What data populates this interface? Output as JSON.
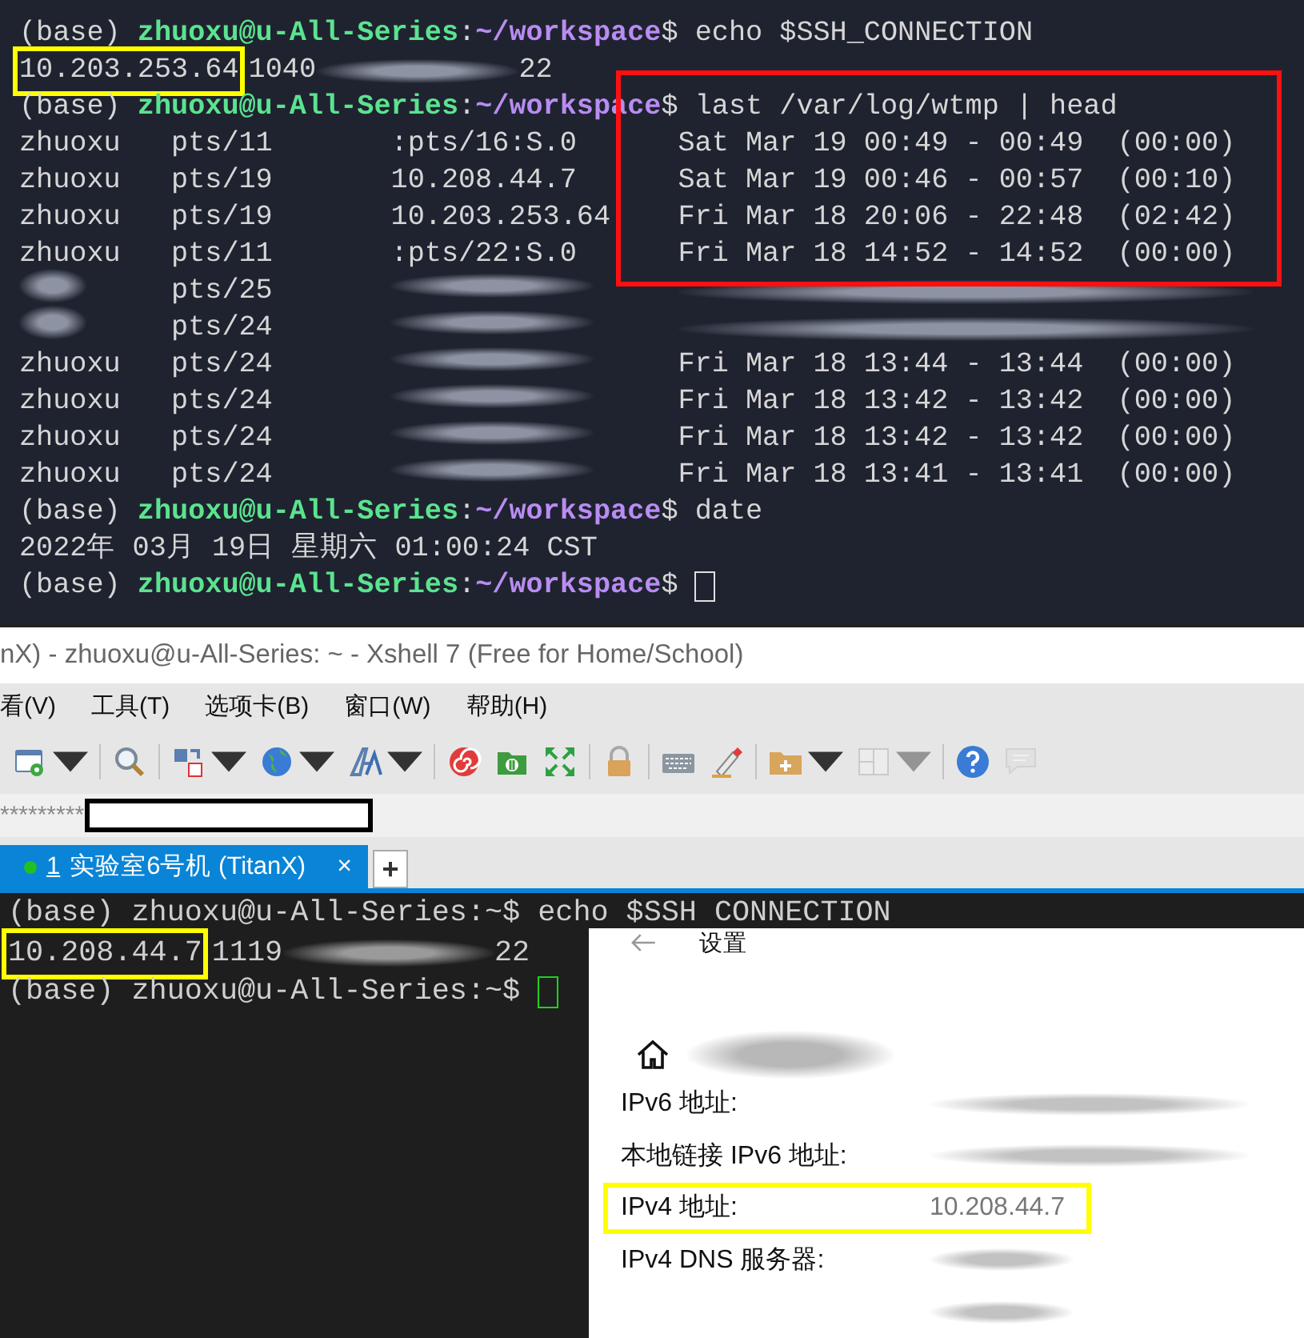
{
  "terminal_top": {
    "framed_region": true,
    "lines": [
      {
        "kind": "prompt",
        "env": "(base)",
        "user_host": "zhuoxu@u-All-Series",
        "separator": ":",
        "path": "~/workspace",
        "sigil": "$",
        "command": "echo $SSH_CONNECTION"
      },
      {
        "kind": "output",
        "segments": [
          {
            "kind": "text",
            "text": "10.203.253.64",
            "highlighted": true
          },
          {
            "kind": "text",
            "text": "1040"
          },
          {
            "kind": "blurred"
          },
          {
            "kind": "text",
            "text": "22"
          }
        ]
      },
      {
        "kind": "prompt",
        "env": "(base)",
        "user_host": "zhuoxu@u-All-Series",
        "separator": ":",
        "path": "~/workspace",
        "sigil": "$",
        "command": "last /var/log/wtmp | head"
      },
      {
        "kind": "login",
        "user": "zhuoxu",
        "tty": "pts/11",
        "from": ":pts/16:S.0",
        "time": "Sat Mar 19 00:49 - 00:49  (00:00)"
      },
      {
        "kind": "login",
        "user": "zhuoxu",
        "tty": "pts/19",
        "from": "10.208.44.7",
        "time": "Sat Mar 19 00:46 - 00:57  (00:10)"
      },
      {
        "kind": "login",
        "user": "zhuoxu",
        "tty": "pts/19",
        "from": "10.203.253.64",
        "time": "Fri Mar 18 20:06 - 22:48  (02:42)"
      },
      {
        "kind": "login",
        "user": "zhuoxu",
        "tty": "pts/11",
        "from": ":pts/22:S.0",
        "time": "Fri Mar 18 14:52 - 14:52  (00:00)"
      },
      {
        "kind": "login",
        "tty": "pts/25"
      },
      {
        "kind": "login",
        "tty": "pts/24"
      },
      {
        "kind": "login",
        "user": "zhuoxu",
        "tty": "pts/24",
        "time": "Fri Mar 18 13:44 - 13:44  (00:00)"
      },
      {
        "kind": "login",
        "user": "zhuoxu",
        "tty": "pts/24",
        "time": "Fri Mar 18 13:42 - 13:42  (00:00)"
      },
      {
        "kind": "login",
        "user": "zhuoxu",
        "tty": "pts/24",
        "time": "Fri Mar 18 13:42 - 13:42  (00:00)"
      },
      {
        "kind": "login",
        "user": "zhuoxu",
        "tty": "pts/24",
        "time": "Fri Mar 18 13:41 - 13:41  (00:00)"
      },
      {
        "kind": "prompt",
        "env": "(base)",
        "user_host": "zhuoxu@u-All-Series",
        "separator": ":",
        "path": "~/workspace",
        "sigil": "$",
        "command": "date"
      },
      {
        "kind": "output",
        "segments": [
          {
            "kind": "text",
            "text": "2022年 03月 19日 星期六 01:00:24 CST"
          }
        ]
      },
      {
        "kind": "prompt",
        "env": "(base)",
        "user_host": "zhuoxu@u-All-Series",
        "separator": ":",
        "path": "~/workspace",
        "sigil": "$",
        "cursor": true
      }
    ]
  },
  "xshell": {
    "title": "nX) - zhuoxu@u-All-Series: ~ - Xshell 7 (Free for Home/School)",
    "menu": [
      "看(V)",
      "工具(T)",
      "选项卡(B)",
      "窗口(W)",
      "帮助(H)"
    ],
    "toolbar": [
      {
        "kind": "session-properties",
        "dropdown": true,
        "disabled": false
      },
      {
        "kind": "search",
        "disabled": false
      },
      {
        "kind": "transfer",
        "dropdown": true,
        "disabled": false
      },
      {
        "kind": "globe",
        "dropdown": true,
        "disabled": false
      },
      {
        "kind": "font",
        "dropdown": true,
        "disabled": false
      },
      {
        "kind": "spiral",
        "disabled": false
      },
      {
        "kind": "green-folder",
        "disabled": false
      },
      {
        "kind": "fullscreen",
        "disabled": false
      },
      {
        "kind": "lock",
        "disabled": false
      },
      {
        "kind": "keyboard",
        "disabled": false
      },
      {
        "kind": "pen",
        "disabled": false
      },
      {
        "kind": "new-folder",
        "dropdown": true,
        "disabled": false
      },
      {
        "kind": "layout",
        "dropdown": true,
        "disabled": true
      },
      {
        "kind": "help",
        "disabled": false
      },
      {
        "kind": "chat",
        "disabled": true
      }
    ],
    "address": "*********",
    "tabs": [
      {
        "number": "1",
        "label": "实验室6号机 (TitanX)",
        "selected": true,
        "connected": true,
        "close": "×"
      }
    ],
    "new_tab": "+"
  },
  "terminal_bottom": {
    "lines": [
      {
        "kind": "prompt",
        "env": "(base)",
        "user_host": "zhuoxu@u-All-Series",
        "separator": ":",
        "path": "~",
        "sigil": "$",
        "command": "echo $SSH CONNECTION"
      },
      {
        "kind": "output",
        "segments": [
          {
            "kind": "text",
            "text": "10.208.44.7",
            "highlighted": true
          },
          {
            "kind": "text",
            "text": "1119"
          },
          {
            "kind": "blurred"
          },
          {
            "kind": "text",
            "text": "22"
          }
        ]
      },
      {
        "kind": "prompt",
        "env": "(base)",
        "user_host": "zhuoxu@u-All-Series",
        "separator": ":",
        "path": "~",
        "sigil": "$",
        "cursor": true
      }
    ]
  },
  "settings": {
    "title": "设置",
    "rows": [
      {
        "label": "IPv6 地址:"
      },
      {
        "label": "本地链接 IPv6 地址:"
      },
      {
        "label": "IPv4 地址:",
        "value": "10.208.44.7",
        "highlighted": true
      },
      {
        "label": "IPv4 DNS 服务器:"
      },
      {}
    ]
  }
}
